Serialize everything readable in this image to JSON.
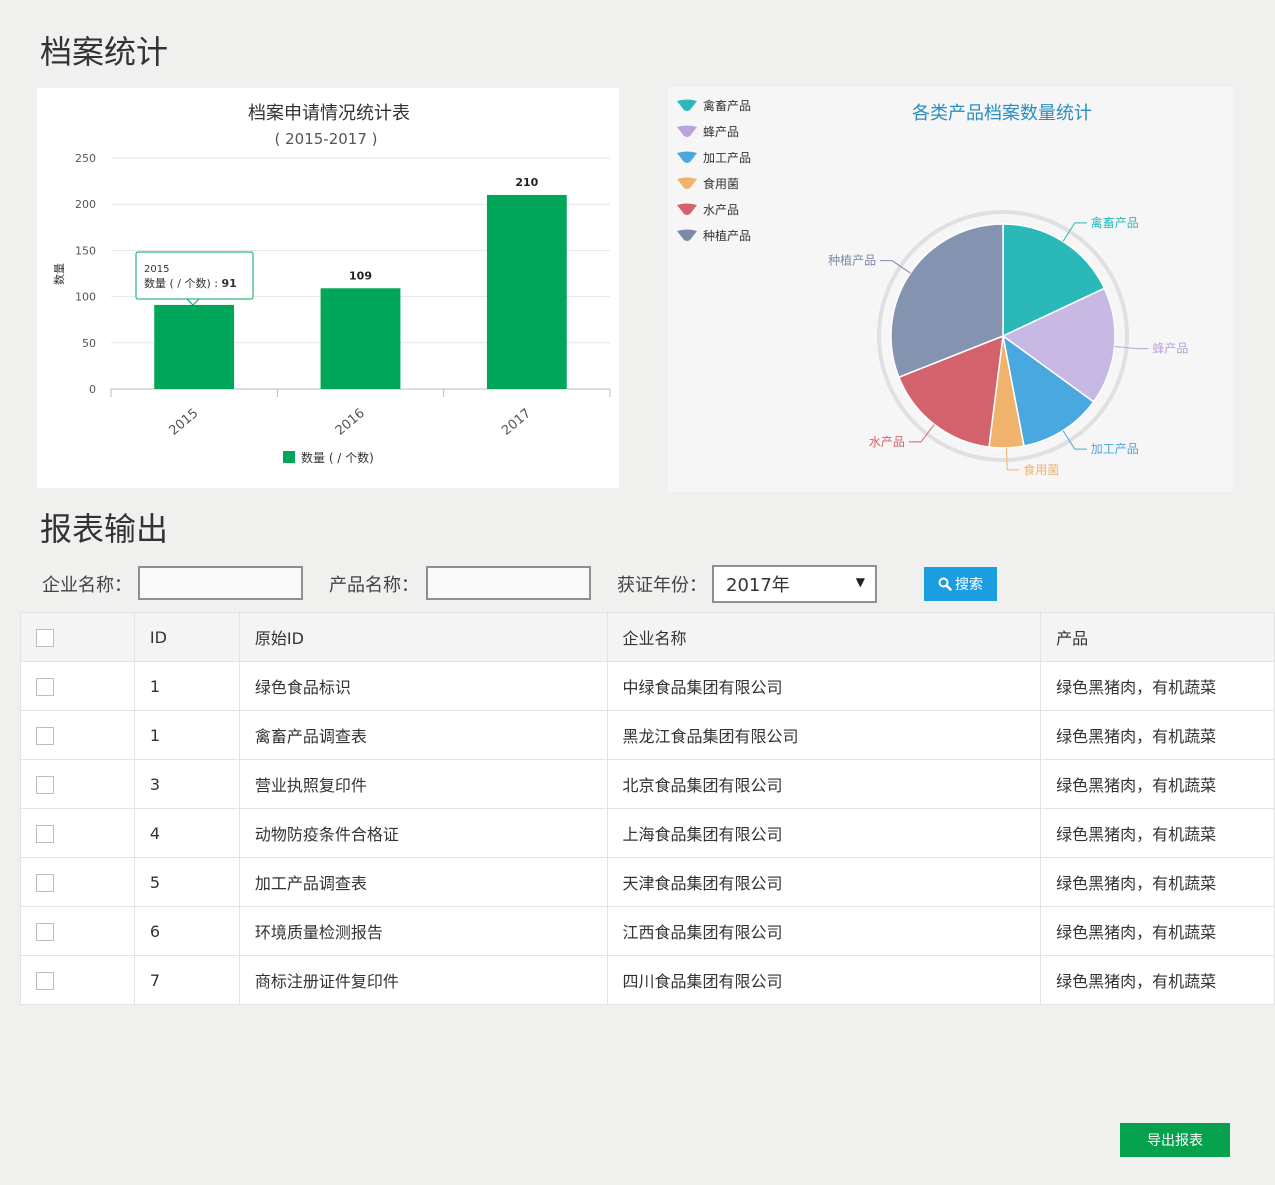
{
  "page": {
    "stats_title": "档案统计",
    "report_title": "报表输出"
  },
  "bar_chart": {
    "title": "档案申请情况统计表",
    "subtitle": "( 2015-2017 )",
    "ylabel": "数量",
    "legend_label": "数量 ( / 个数)",
    "tooltip_year": "2015",
    "tooltip_label": "数量 ( / 个数) : ",
    "tooltip_value": "91",
    "color": "#00a65a"
  },
  "pie_chart": {
    "title": "各类产品档案数量统计",
    "legend": [
      {
        "label": "禽畜产品",
        "color": "#2ab8b8"
      },
      {
        "label": "蜂产品",
        "color": "#b9a4dc"
      },
      {
        "label": "加工产品",
        "color": "#4aa8e0"
      },
      {
        "label": "食用菌",
        "color": "#efb36e"
      },
      {
        "label": "水产品",
        "color": "#d4626c"
      },
      {
        "label": "种植产品",
        "color": "#7b8aa8"
      }
    ]
  },
  "chart_data": [
    {
      "type": "bar",
      "title": "档案申请情况统计表",
      "subtitle": "( 2015-2017 )",
      "categories": [
        "2015",
        "2016",
        "2017"
      ],
      "series": [
        {
          "name": "数量 ( / 个数)",
          "values": [
            91,
            109,
            210
          ]
        }
      ],
      "ylabel": "数量",
      "ylim": [
        0,
        250
      ],
      "yticks": [
        0,
        50,
        100,
        150,
        200,
        250
      ],
      "grid": true,
      "legend_position": "bottom"
    },
    {
      "type": "pie",
      "title": "各类产品档案数量统计",
      "labels": [
        "禽畜产品",
        "蜂产品",
        "加工产品",
        "食用菌",
        "水产品",
        "种植产品"
      ],
      "values": [
        18,
        17,
        12,
        5,
        17,
        31
      ],
      "colors": [
        "#2ab8b8",
        "#c8b9e4",
        "#4aa8e0",
        "#efb36e",
        "#d4626c",
        "#8493b0"
      ],
      "legend_position": "top-left"
    }
  ],
  "filters": {
    "company_label": "企业名称：",
    "product_label": "产品名称：",
    "year_label": "获证年份：",
    "year_value": "2017年",
    "search_label": "搜索"
  },
  "table": {
    "headers": [
      "ID",
      "原始ID",
      "企业名称",
      "产品"
    ],
    "rows": [
      {
        "id": "1",
        "original": "绿色食品标识",
        "company": "中绿食品集团有限公司",
        "product": "绿色黑猪肉，有机蔬菜"
      },
      {
        "id": "1",
        "original": "禽畜产品调查表",
        "company": "黑龙江食品集团有限公司",
        "product": "绿色黑猪肉，有机蔬菜"
      },
      {
        "id": "3",
        "original": "营业执照复印件",
        "company": "北京食品集团有限公司",
        "product": "绿色黑猪肉，有机蔬菜"
      },
      {
        "id": "4",
        "original": "动物防疫条件合格证",
        "company": "上海食品集团有限公司",
        "product": "绿色黑猪肉，有机蔬菜"
      },
      {
        "id": "5",
        "original": "加工产品调查表",
        "company": "天津食品集团有限公司",
        "product": "绿色黑猪肉，有机蔬菜"
      },
      {
        "id": "6",
        "original": "环境质量检测报告",
        "company": "江西食品集团有限公司",
        "product": "绿色黑猪肉，有机蔬菜"
      },
      {
        "id": "7",
        "original": "商标注册证件复印件",
        "company": "四川食品集团有限公司",
        "product": "绿色黑猪肉，有机蔬菜"
      }
    ]
  },
  "export_label": "导出报表"
}
